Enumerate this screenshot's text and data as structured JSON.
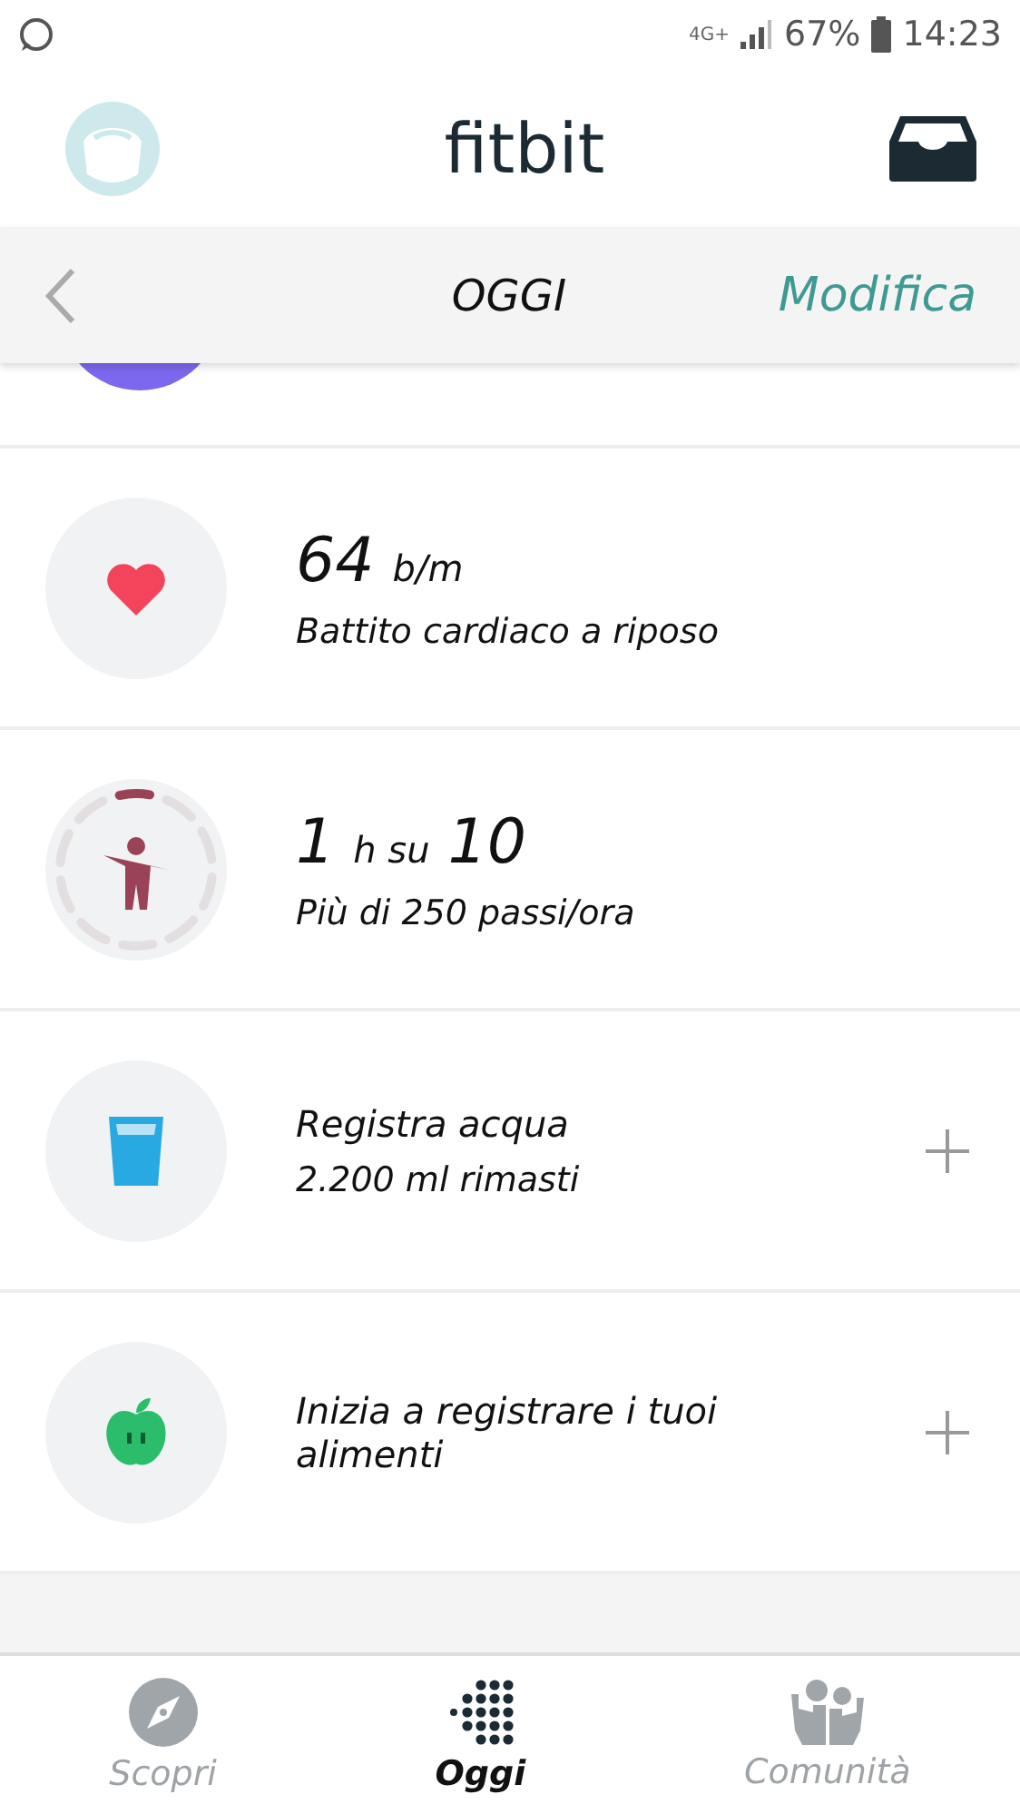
{
  "status_bar": {
    "network": "4G+",
    "battery": "67%",
    "time": "14:23"
  },
  "header": {
    "title": "fitbit"
  },
  "subheader": {
    "title": "OGGI",
    "action": "Modifica"
  },
  "tiles": [
    {
      "kind": "heart",
      "title_parts": [
        {
          "kind": "number",
          "text": "64"
        },
        {
          "kind": "text",
          "text": "b/m"
        }
      ],
      "subtitle": "Battito cardiaco a riposo",
      "add": false
    },
    {
      "kind": "activity",
      "level": 0.1,
      "title_parts": [
        {
          "kind": "number",
          "text": "1"
        },
        {
          "kind": "text",
          "text": "h su"
        },
        {
          "kind": "number",
          "text": "10"
        }
      ],
      "subtitle": "Più di 250 passi/ora",
      "add": false
    },
    {
      "kind": "water",
      "title_parts": [
        {
          "kind": "text",
          "text": "Registra acqua"
        }
      ],
      "subtitle": "2.200 ml rimasti",
      "add": true
    },
    {
      "kind": "food",
      "title_parts": [
        {
          "kind": "text",
          "text": "Inizia a registrare i tuoi alimenti"
        }
      ],
      "add": true
    }
  ],
  "nav": [
    {
      "kind": "discover",
      "label": "Scopri",
      "selected": false
    },
    {
      "kind": "today",
      "label": "Oggi",
      "selected": true
    },
    {
      "kind": "community",
      "label": "Comunità",
      "selected": false
    }
  ]
}
